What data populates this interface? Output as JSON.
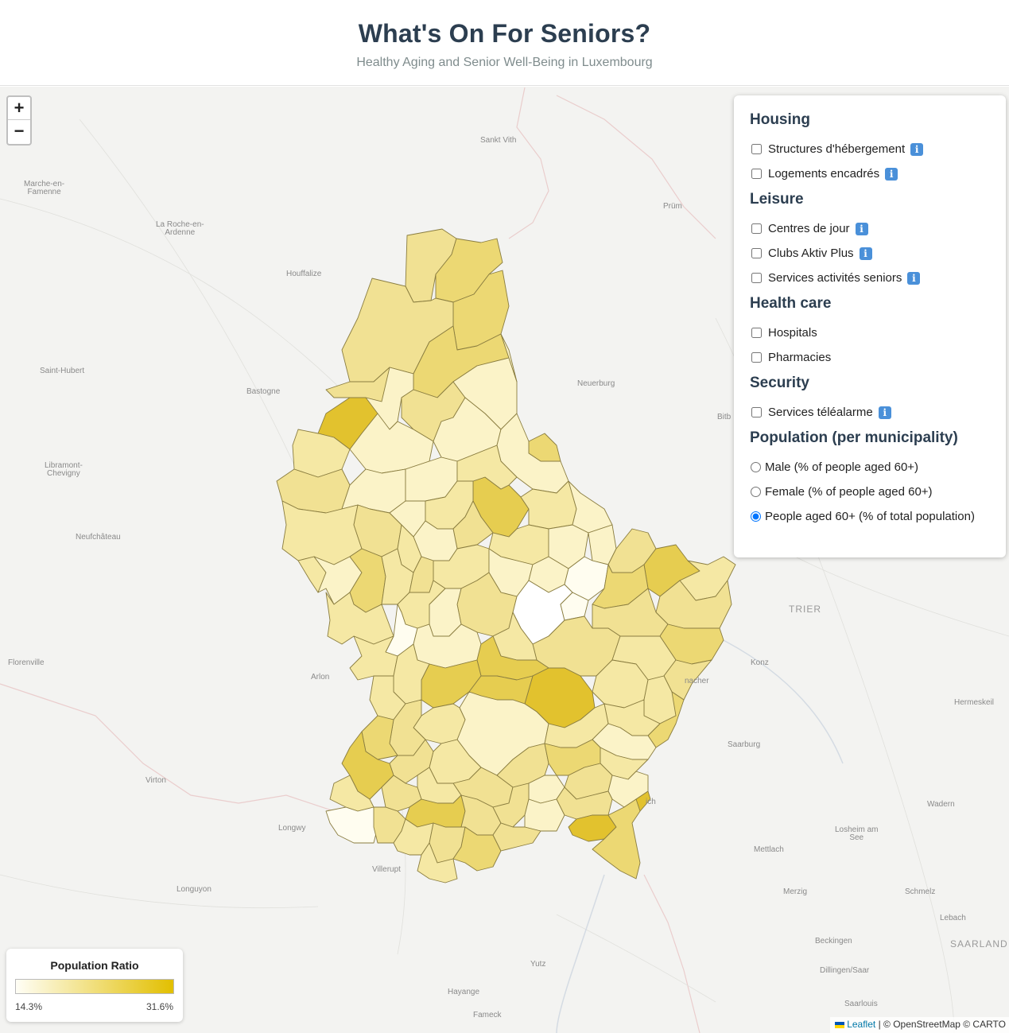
{
  "header": {
    "title": "What's On For Seniors?",
    "subtitle": "Healthy Aging and Senior Well-Being in Luxembourg"
  },
  "zoom": {
    "in_label": "+",
    "out_label": "−"
  },
  "places": [
    {
      "id": "sankt-vith",
      "name": "Sankt Vith"
    },
    {
      "id": "marche",
      "name": "Marche-en-\nFamenne"
    },
    {
      "id": "la-roche",
      "name": "La Roche-en-\nArdenne"
    },
    {
      "id": "prum",
      "name": "Prüm"
    },
    {
      "id": "houffalize",
      "name": "Houffalize"
    },
    {
      "id": "saint-hubert",
      "name": "Saint-Hubert"
    },
    {
      "id": "bastogne",
      "name": "Bastogne"
    },
    {
      "id": "neuerburg",
      "name": "Neuerburg"
    },
    {
      "id": "bitb",
      "name": "Bitb"
    },
    {
      "id": "libramont",
      "name": "Libramont-\nChevigny"
    },
    {
      "id": "neufchateau",
      "name": "Neufchâteau"
    },
    {
      "id": "trier",
      "name": "TRIER"
    },
    {
      "id": "konz",
      "name": "Konz"
    },
    {
      "id": "florenville",
      "name": "Florenville"
    },
    {
      "id": "arlon",
      "name": "Arlon"
    },
    {
      "id": "nacher",
      "name": "nacher"
    },
    {
      "id": "hermeskeil",
      "name": "Hermeskeil"
    },
    {
      "id": "saarburg",
      "name": "Saarburg"
    },
    {
      "id": "virton",
      "name": "Virton"
    },
    {
      "id": "wadern",
      "name": "Wadern"
    },
    {
      "id": "longwy",
      "name": "Longwy"
    },
    {
      "id": "ich",
      "name": "ich"
    },
    {
      "id": "losheim",
      "name": "Losheim am\nSee"
    },
    {
      "id": "mettlach",
      "name": "Mettlach"
    },
    {
      "id": "villerupt",
      "name": "Villerupt"
    },
    {
      "id": "longuyon",
      "name": "Longuyon"
    },
    {
      "id": "merzig",
      "name": "Merzig"
    },
    {
      "id": "schmelz",
      "name": "Schmelz"
    },
    {
      "id": "lebach",
      "name": "Lebach"
    },
    {
      "id": "beckingen",
      "name": "Beckingen"
    },
    {
      "id": "saarland",
      "name": "SAARLAND"
    },
    {
      "id": "dillingen",
      "name": "Dillingen/Saar"
    },
    {
      "id": "yutz",
      "name": "Yutz"
    },
    {
      "id": "hayange",
      "name": "Hayange"
    },
    {
      "id": "saarlouis",
      "name": "Saarlouis"
    },
    {
      "id": "fameck",
      "name": "Fameck"
    }
  ],
  "panel": {
    "sections": [
      {
        "title": "Housing",
        "items": [
          {
            "label": "Structures d'hébergement",
            "checked": false,
            "info": true
          },
          {
            "label": "Logements encadrés",
            "checked": false,
            "info": true
          }
        ]
      },
      {
        "title": "Leisure",
        "items": [
          {
            "label": "Centres de jour",
            "checked": false,
            "info": true
          },
          {
            "label": "Clubs Aktiv Plus",
            "checked": false,
            "info": true
          },
          {
            "label": "Services activités seniors",
            "checked": false,
            "info": true
          }
        ]
      },
      {
        "title": "Health care",
        "items": [
          {
            "label": "Hospitals",
            "checked": false,
            "info": false
          },
          {
            "label": "Pharmacies",
            "checked": false,
            "info": false
          }
        ]
      },
      {
        "title": "Security",
        "items": [
          {
            "label": "Services téléalarme",
            "checked": false,
            "info": true
          }
        ]
      }
    ],
    "population": {
      "title": "Population (per municipality)",
      "options": [
        {
          "label": "Male (% of people aged 60+)",
          "selected": false
        },
        {
          "label": "Female (% of people aged 60+)",
          "selected": false
        },
        {
          "label": "People aged 60+ (% of total population)",
          "selected": true
        }
      ]
    },
    "info_glyph": "i"
  },
  "legend": {
    "title": "Population Ratio",
    "min": "14.3%",
    "max": "31.6%",
    "color_low": "#fffef6",
    "color_high": "#e2bf00"
  },
  "attribution": {
    "leaflet": "Leaflet",
    "rest": " | © OpenStreetMap © CARTO"
  },
  "colors": {
    "ratio_fills": [
      "#fffdf0",
      "#fbf3c8",
      "#f5e8a4",
      "#f1e193",
      "#ecd873",
      "#e6cd50",
      "#e2c22e",
      "#ffffff"
    ]
  }
}
